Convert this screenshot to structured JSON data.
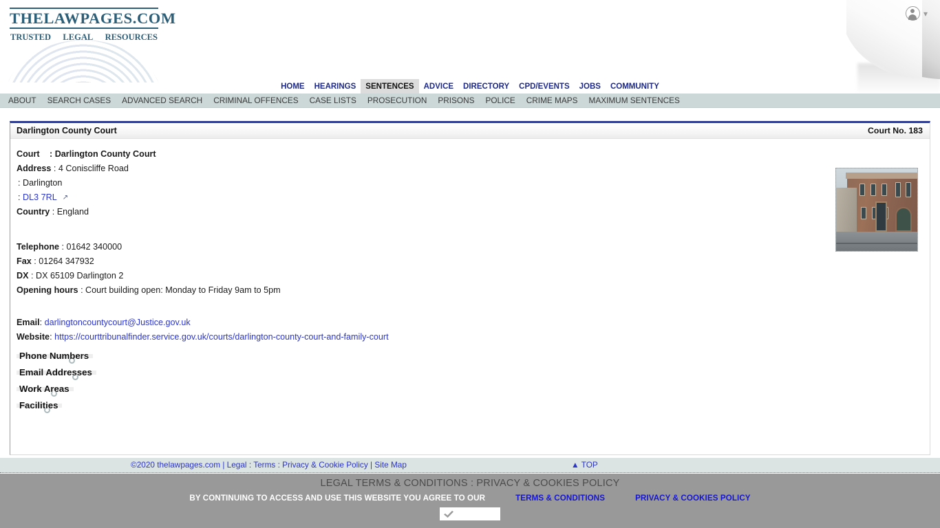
{
  "site": {
    "logo_word": "THELAWPAGES.COM",
    "tagline_1": "TRUSTED",
    "tagline_2": "LEGAL",
    "tagline_3": "RESOURCES",
    "accent_navy": "#1d2a8c",
    "accent_teal": "#2d5e78",
    "link_blue": "#2b35c8"
  },
  "account": {
    "icon": "user-account-icon",
    "chevron": "⌄"
  },
  "main_nav": [
    {
      "label": "HOME",
      "active": false
    },
    {
      "label": "HEARINGS",
      "active": false
    },
    {
      "label": "SENTENCES",
      "active": true
    },
    {
      "label": "ADVICE",
      "active": false
    },
    {
      "label": "DIRECTORY",
      "active": false
    },
    {
      "label": "CPD/EVENTS",
      "active": false
    },
    {
      "label": "JOBS",
      "active": false
    },
    {
      "label": "COMMUNITY",
      "active": false
    }
  ],
  "sub_nav": [
    {
      "label": "ABOUT"
    },
    {
      "label": "SEARCH CASES"
    },
    {
      "label": "ADVANCED SEARCH"
    },
    {
      "label": "CRIMINAL OFFENCES"
    },
    {
      "label": "CASE LISTS"
    },
    {
      "label": "PROSECUTION"
    },
    {
      "label": "PRISONS"
    },
    {
      "label": "POLICE"
    },
    {
      "label": "CRIME MAPS"
    },
    {
      "label": "MAXIMUM SENTENCES"
    }
  ],
  "panel": {
    "title": "Darlington County Court",
    "court_number": "Court No. 183"
  },
  "details": {
    "court_label": "Court",
    "court_sep": ":",
    "court_value": "Darlington County Court",
    "address_label": "Address",
    "address_line_1": ": 4 Coniscliffe Road",
    "address_line_2": ": Darlington",
    "postcode_sep": ":",
    "postcode": "DL3 7RL",
    "map_icon": "↗",
    "country_label": "Country",
    "country_value": ": England",
    "telephone_label": "Telephone",
    "telephone_value": ": 01642 340000",
    "fax_label": "Fax",
    "fax_value": ": 01264 347932",
    "dx_label": "DX",
    "dx_value": ": DX 65109 Darlington 2",
    "opening_label": "Opening hours",
    "opening_value": ": Court building open: Monday to Friday 9am to 5pm",
    "email_label": "Email",
    "email_sep": ":",
    "email_value": "darlingtoncountycourt@Justice.gov.uk",
    "website_label": "Website",
    "website_sep": ":",
    "website_value": "https://courttribunalfinder.service.gov.uk/courts/darlington-county-court-and-family-court"
  },
  "photo": {
    "alt": "courthouse-building-photo"
  },
  "accordions": [
    {
      "label": "Phone Numbers"
    },
    {
      "label": "Email Addresses"
    },
    {
      "label": "Work Areas"
    },
    {
      "label": "Facilities"
    }
  ],
  "footer": {
    "copyright": "©2020 thelawpages.com",
    "sep1": "|",
    "legal": "Legal",
    "colon1": ":",
    "terms": "Terms",
    "colon2": ":",
    "privacy": "Privacy & Cookie Policy",
    "sep2": "|",
    "sitemap": "Site Map",
    "top": "▲ TOP"
  },
  "cookie_banner": {
    "title": "LEGAL TERMS & CONDITIONS : PRIVACY & COOKIES POLICY",
    "notice": "BY CONTINUING TO ACCESS AND USE THIS WEBSITE YOU AGREE TO OUR",
    "terms_link": "TERMS & CONDITIONS",
    "privacy_link": "PRIVACY & COOKIES POLICY",
    "accept_icon": "check-icon",
    "accept_label": ""
  }
}
